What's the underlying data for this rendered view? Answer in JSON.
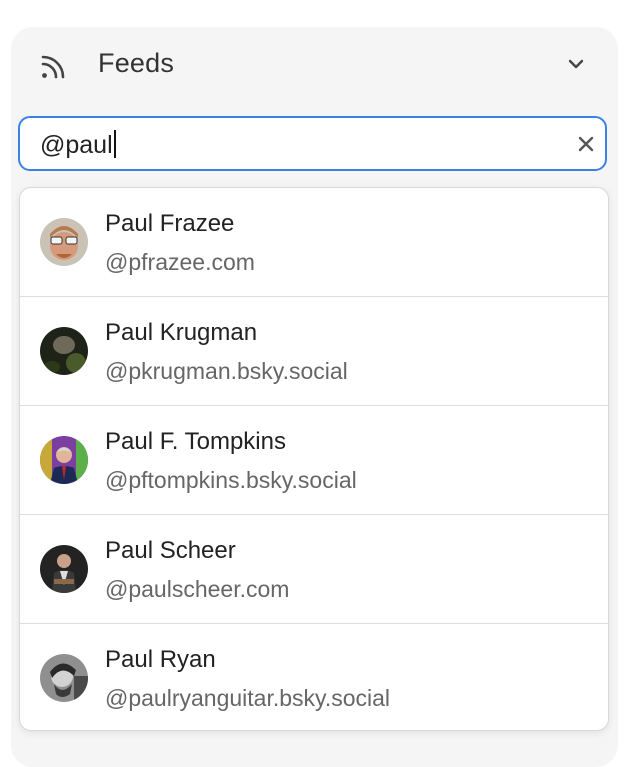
{
  "header": {
    "title": "Feeds",
    "icon": "rss-feed-icon",
    "toggle_icon": "chevron-down-icon"
  },
  "search": {
    "value": "@paul",
    "clear_icon": "close-icon",
    "focus_color": "#3b82e6"
  },
  "results": [
    {
      "name": "Paul Frazee",
      "handle": "@pfrazee.com"
    },
    {
      "name": "Paul Krugman",
      "handle": "@pkrugman.bsky.social"
    },
    {
      "name": "Paul F. Tompkins",
      "handle": "@pftompkins.bsky.social"
    },
    {
      "name": "Paul Scheer",
      "handle": "@paulscheer.com"
    },
    {
      "name": "Paul Ryan",
      "handle": "@paulryanguitar.bsky.social"
    }
  ]
}
